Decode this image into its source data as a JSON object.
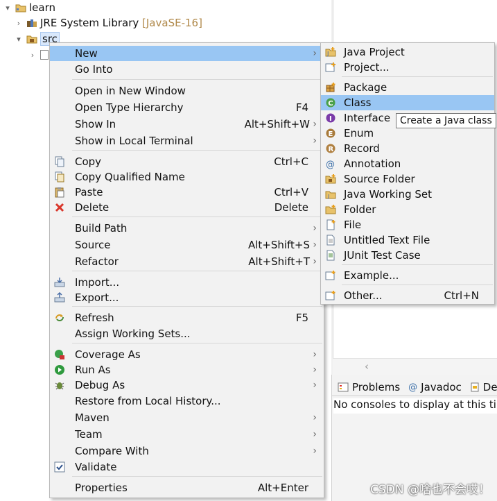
{
  "tree": {
    "project": "learn",
    "jre": "JRE System Library",
    "jre_version": "[JavaSE-16]",
    "src": "src"
  },
  "context_menu": {
    "items": [
      {
        "label": "New",
        "shortcut": "",
        "submenu": true,
        "icon": ""
      },
      {
        "label": "Go Into",
        "shortcut": "",
        "submenu": false,
        "icon": ""
      },
      {
        "label": "Open in New Window",
        "shortcut": "",
        "submenu": false,
        "icon": ""
      },
      {
        "label": "Open Type Hierarchy",
        "shortcut": "F4",
        "submenu": false,
        "icon": ""
      },
      {
        "label": "Show In",
        "shortcut": "Alt+Shift+W",
        "submenu": true,
        "icon": ""
      },
      {
        "label": "Show in Local Terminal",
        "shortcut": "",
        "submenu": true,
        "icon": ""
      },
      {
        "label": "Copy",
        "shortcut": "Ctrl+C",
        "submenu": false,
        "icon": "copy-icon"
      },
      {
        "label": "Copy Qualified Name",
        "shortcut": "",
        "submenu": false,
        "icon": "copy-qualified-icon"
      },
      {
        "label": "Paste",
        "shortcut": "Ctrl+V",
        "submenu": false,
        "icon": "paste-icon"
      },
      {
        "label": "Delete",
        "shortcut": "Delete",
        "submenu": false,
        "icon": "delete-icon"
      },
      {
        "label": "Build Path",
        "shortcut": "",
        "submenu": true,
        "icon": ""
      },
      {
        "label": "Source",
        "shortcut": "Alt+Shift+S",
        "submenu": true,
        "icon": ""
      },
      {
        "label": "Refactor",
        "shortcut": "Alt+Shift+T",
        "submenu": true,
        "icon": ""
      },
      {
        "label": "Import...",
        "shortcut": "",
        "submenu": false,
        "icon": "import-icon"
      },
      {
        "label": "Export...",
        "shortcut": "",
        "submenu": false,
        "icon": "export-icon"
      },
      {
        "label": "Refresh",
        "shortcut": "F5",
        "submenu": false,
        "icon": "refresh-icon"
      },
      {
        "label": "Assign Working Sets...",
        "shortcut": "",
        "submenu": false,
        "icon": ""
      },
      {
        "label": "Coverage As",
        "shortcut": "",
        "submenu": true,
        "icon": "coverage-icon"
      },
      {
        "label": "Run As",
        "shortcut": "",
        "submenu": true,
        "icon": "run-icon"
      },
      {
        "label": "Debug As",
        "shortcut": "",
        "submenu": true,
        "icon": "debug-icon"
      },
      {
        "label": "Restore from Local History...",
        "shortcut": "",
        "submenu": false,
        "icon": ""
      },
      {
        "label": "Maven",
        "shortcut": "",
        "submenu": true,
        "icon": ""
      },
      {
        "label": "Team",
        "shortcut": "",
        "submenu": true,
        "icon": ""
      },
      {
        "label": "Compare With",
        "shortcut": "",
        "submenu": true,
        "icon": ""
      },
      {
        "label": "Validate",
        "shortcut": "",
        "submenu": false,
        "icon": "validate-check-icon"
      },
      {
        "label": "Properties",
        "shortcut": "Alt+Enter",
        "submenu": false,
        "icon": ""
      }
    ]
  },
  "new_submenu": {
    "items": [
      {
        "label": "Java Project",
        "shortcut": "",
        "icon": "java-project-icon"
      },
      {
        "label": "Project...",
        "shortcut": "",
        "icon": "project-icon"
      },
      {
        "label": "Package",
        "shortcut": "",
        "icon": "package-icon"
      },
      {
        "label": "Class",
        "shortcut": "",
        "icon": "class-icon"
      },
      {
        "label": "Interface",
        "shortcut": "",
        "icon": "interface-icon"
      },
      {
        "label": "Enum",
        "shortcut": "",
        "icon": "enum-icon"
      },
      {
        "label": "Record",
        "shortcut": "",
        "icon": "record-icon"
      },
      {
        "label": "Annotation",
        "shortcut": "",
        "icon": "annotation-icon"
      },
      {
        "label": "Source Folder",
        "shortcut": "",
        "icon": "source-folder-icon"
      },
      {
        "label": "Java Working Set",
        "shortcut": "",
        "icon": "working-set-icon"
      },
      {
        "label": "Folder",
        "shortcut": "",
        "icon": "folder-icon"
      },
      {
        "label": "File",
        "shortcut": "",
        "icon": "file-icon"
      },
      {
        "label": "Untitled Text File",
        "shortcut": "",
        "icon": "text-file-icon"
      },
      {
        "label": "JUnit Test Case",
        "shortcut": "",
        "icon": "junit-icon"
      },
      {
        "label": "Example...",
        "shortcut": "",
        "icon": "example-icon"
      },
      {
        "label": "Other...",
        "shortcut": "Ctrl+N",
        "icon": "other-icon"
      }
    ],
    "tooltip": "Create a Java class"
  },
  "bottom_panel": {
    "tabs": [
      {
        "label": "Problems",
        "icon": "problems-icon"
      },
      {
        "label": "Javadoc",
        "icon": "javadoc-icon"
      },
      {
        "label": "Dec",
        "icon": "declaration-icon"
      }
    ],
    "console_message": "No consoles to display at this tim"
  },
  "watermark": "CSDN @啥也不会哎！",
  "colors": {
    "highlight": "#99c6f3",
    "menu_bg": "#f2f2f2",
    "delete_red": "#d9362b"
  }
}
